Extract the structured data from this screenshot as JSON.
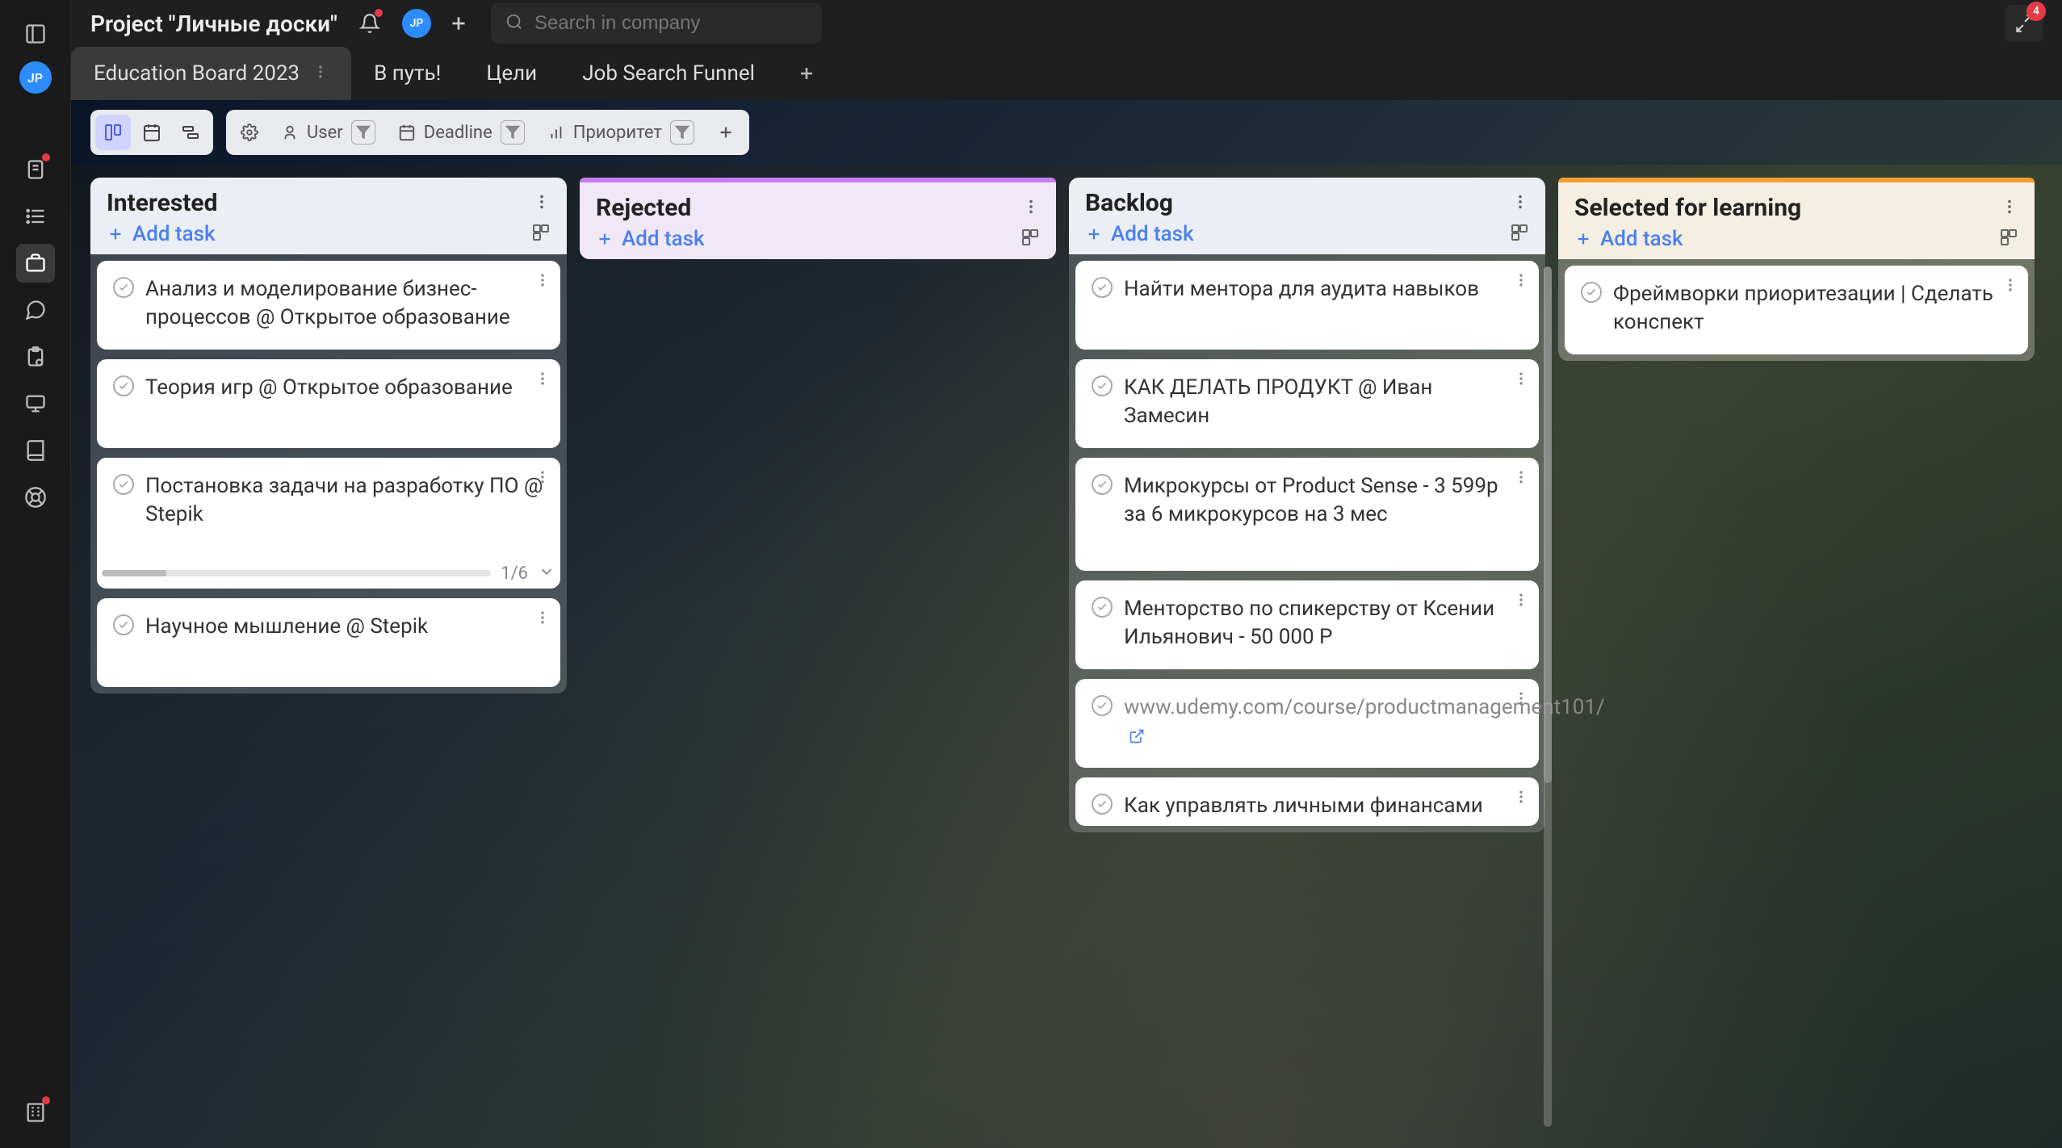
{
  "header": {
    "project_title": "Project \"Личные доски\"",
    "avatar_initials": "JP",
    "search_placeholder": "Search in company",
    "notification_badge": "4"
  },
  "tabs": [
    {
      "label": "Education Board 2023",
      "active": true
    },
    {
      "label": "В путь!",
      "active": false
    },
    {
      "label": "Цели",
      "active": false
    },
    {
      "label": "Job Search Funnel",
      "active": false
    }
  ],
  "filters": {
    "user_label": "User",
    "deadline_label": "Deadline",
    "priority_label": "Приоритет"
  },
  "columns": [
    {
      "title": "Interested",
      "add_label": "Add task",
      "stripe": null,
      "cards": [
        {
          "text": "Анализ и моделирование бизнес-процессов @ Открытое образование"
        },
        {
          "text": "Теория игр @ Открытое образование"
        },
        {
          "text": "Постановка задачи на разработку ПО @ Stepik",
          "progress": "1/6"
        },
        {
          "text": "Научное мышление @ Stepik"
        }
      ]
    },
    {
      "title": "Rejected",
      "add_label": "Add task",
      "stripe": "#c77ef0",
      "cards": []
    },
    {
      "title": "Backlog",
      "add_label": "Add task",
      "stripe": null,
      "cards": [
        {
          "text": "Найти ментора для аудита навыков"
        },
        {
          "text": "КАК ДЕЛАТЬ ПРОДУКТ @ Иван Замесин"
        },
        {
          "text": "Микрокурсы от Product Sense - 3 599р за 6 микрокурсов на 3 мес"
        },
        {
          "text": "Менторство по спикерству от Ксении Ильянович - 50 000 Р"
        },
        {
          "text": "www.udemy.com/course/productmanagement101/",
          "link": true
        },
        {
          "text": "Как управлять личными финансами"
        }
      ]
    },
    {
      "title": "Selected for learning",
      "add_label": "Add task",
      "stripe": "#f0a030",
      "cards": [
        {
          "text": "Фреймворки приоритезации | Сделать конспект"
        }
      ]
    }
  ]
}
